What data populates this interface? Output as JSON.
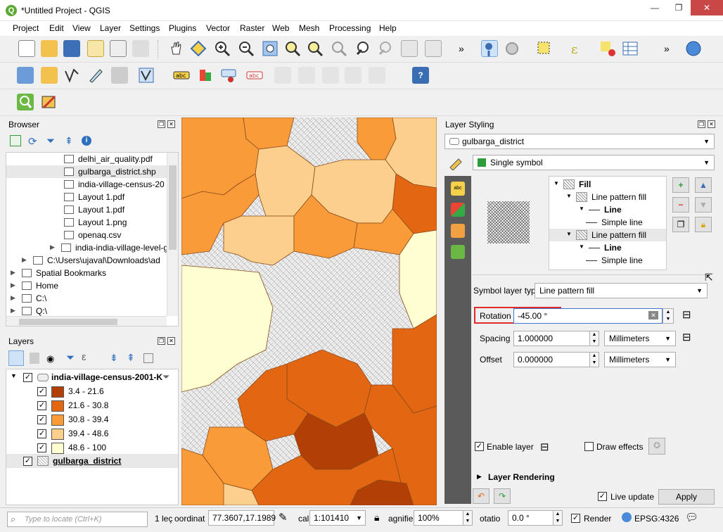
{
  "window": {
    "title": "*Untitled Project - QGIS",
    "logo_letter": "Q",
    "min": "—",
    "max": "❐",
    "close": "✕"
  },
  "menu": [
    "Project",
    "Edit",
    "View",
    "Layer",
    "Settings",
    "Plugins",
    "Vector",
    "Raster",
    "Web",
    "Mesh",
    "Processing",
    "Help"
  ],
  "toolbar_overflow": "»",
  "browser": {
    "title": "Browser",
    "items": [
      {
        "label": "delhi_air_quality.pdf",
        "indent": 2
      },
      {
        "label": "gulbarga_district.shp",
        "indent": 2
      },
      {
        "label": "india-village-census-20",
        "indent": 2
      },
      {
        "label": "Layout 1.pdf",
        "indent": 2
      },
      {
        "label": "Layout 1.pdf",
        "indent": 2
      },
      {
        "label": "Layout 1.png",
        "indent": 2
      },
      {
        "label": "openaq.csv",
        "indent": 2
      },
      {
        "label": "india-india-village-level-ge",
        "indent": 1
      },
      {
        "label": "C:\\Users\\ujaval\\Downloads\\ad",
        "indent": 0
      },
      {
        "label": "Spatial Bookmarks",
        "indent": -1
      },
      {
        "label": "Home",
        "indent": -1
      },
      {
        "label": "C:\\",
        "indent": -1
      },
      {
        "label": "Q:\\",
        "indent": -1
      }
    ]
  },
  "layers": {
    "title": "Layers",
    "layer1": "india-village-census-2001-K",
    "classes": [
      {
        "label": "3.4 - 21.6",
        "color": "#b23f05"
      },
      {
        "label": "21.6 - 30.8",
        "color": "#e36712"
      },
      {
        "label": "30.8 - 39.4",
        "color": "#fa9b3a"
      },
      {
        "label": "39.4 - 48.6",
        "color": "#fdcf8d"
      },
      {
        "label": "48.6 - 100",
        "color": "#ffffd1"
      }
    ],
    "layer2": "gulbarga_district"
  },
  "styling": {
    "title": "Layer Styling",
    "layer": "gulbarga_district",
    "renderer": "Single symbol",
    "tree": [
      {
        "label": "Fill",
        "bold": true,
        "indent": 0
      },
      {
        "label": "Line pattern fill",
        "bold": false,
        "indent": 1
      },
      {
        "label": "Line",
        "bold": true,
        "indent": 2
      },
      {
        "label": "Simple line",
        "bold": false,
        "indent": 3
      },
      {
        "label": "Line pattern fill",
        "bold": false,
        "indent": 1
      },
      {
        "label": "Line",
        "bold": true,
        "indent": 2
      },
      {
        "label": "Simple line",
        "bold": false,
        "indent": 3
      }
    ],
    "symbol_layer_type_label": "Symbol layer type",
    "symbol_layer_type": "Line pattern fill",
    "rotation_label": "Rotation",
    "rotation": "-45.00 °",
    "spacing_label": "Spacing",
    "spacing": "1.000000",
    "offset_label": "Offset",
    "offset": "0.000000",
    "unit": "Millimeters",
    "enable_layer": "Enable layer",
    "draw_effects": "Draw effects",
    "layer_rendering": "Layer Rendering",
    "live_update": "Live update",
    "apply": "Apply"
  },
  "status": {
    "locate_placeholder": "Type to locate (Ctrl+K)",
    "legend": "1 leç",
    "coord_label": "oordinat",
    "coord": "77.3607,17.1989",
    "scale_label": "cal",
    "scale": "1:101410",
    "magnifier_label": "agnifie",
    "magnifier": "100%",
    "rotation_label": "otatio",
    "rotation": "0.0 °",
    "render": "Render",
    "crs": "EPSG:4326"
  }
}
